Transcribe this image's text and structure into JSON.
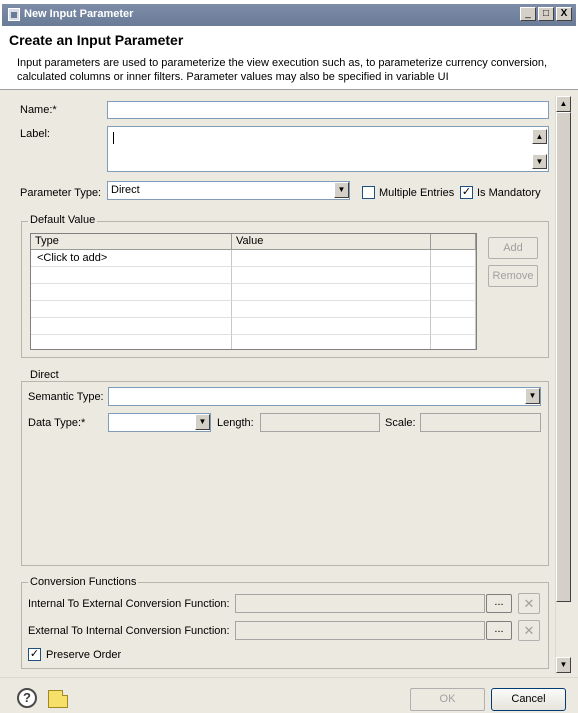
{
  "window": {
    "title": "New Input Parameter",
    "controls": {
      "minimize": "_",
      "maximize": "□",
      "close": "X"
    }
  },
  "header": {
    "title": "Create an Input Parameter",
    "description": "Input parameters are used to parameterize the view execution such as, to parameterize currency conversion, calculated columns or inner filters. Parameter values may also be specified in variable UI"
  },
  "form": {
    "name_label": "Name:*",
    "name_value": "",
    "label_label": "Label:",
    "label_value": "",
    "param_type_label": "Parameter Type:",
    "param_type_value": "Direct",
    "multiple_entries_label": "Multiple Entries",
    "multiple_entries_checked": false,
    "is_mandatory_label": "Is Mandatory",
    "is_mandatory_checked": true
  },
  "default_value": {
    "group_title": "Default Value",
    "columns": [
      "Type",
      "Value",
      ""
    ],
    "rows": [
      [
        "<Click to add>",
        "",
        ""
      ],
      [
        "",
        "",
        ""
      ],
      [
        "",
        "",
        ""
      ],
      [
        "",
        "",
        ""
      ],
      [
        "",
        "",
        ""
      ],
      [
        "",
        "",
        ""
      ]
    ],
    "add_label": "Add",
    "remove_label": "Remove"
  },
  "direct": {
    "group_title": "Direct",
    "semantic_type_label": "Semantic Type:",
    "semantic_type_value": "",
    "data_type_label": "Data Type:*",
    "data_type_value": "",
    "length_label": "Length:",
    "length_value": "",
    "scale_label": "Scale:",
    "scale_value": ""
  },
  "conversion": {
    "group_title": "Conversion Functions",
    "internal_to_external_label": "Internal To External Conversion Function:",
    "external_to_internal_label": "External To Internal Conversion Function:",
    "browse_label": "...",
    "clear_label": "✕",
    "preserve_order_label": "Preserve Order",
    "preserve_order_checked": true
  },
  "footer": {
    "help_label": "?",
    "ok_label": "OK",
    "cancel_label": "Cancel"
  },
  "icons": {
    "app": "window-app-icon",
    "help": "help-icon",
    "note": "note-icon",
    "dropdown": "chevron-down-icon",
    "scroll_up": "arrow-up-icon",
    "scroll_down": "arrow-down-icon"
  }
}
